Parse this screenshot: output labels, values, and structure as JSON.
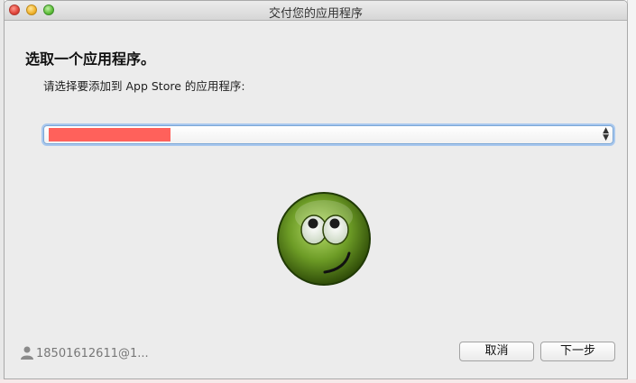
{
  "window": {
    "title": "交付您的应用程序"
  },
  "content": {
    "heading": "选取一个应用程序。",
    "instruction": "请选择要添加到 App Store 的应用程序:"
  },
  "app_select": {
    "selected_value": ""
  },
  "footer": {
    "account_label": "18501612611@1...",
    "cancel_label": "取消",
    "next_label": "下一步"
  },
  "colors": {
    "select_focus": "#7aa6d6",
    "redaction": "#ff615b",
    "smiley": "#4e7d12"
  },
  "icons": {
    "account": "user-icon",
    "select": "up-down-arrows-icon",
    "mascot": "smiley-face-icon"
  }
}
